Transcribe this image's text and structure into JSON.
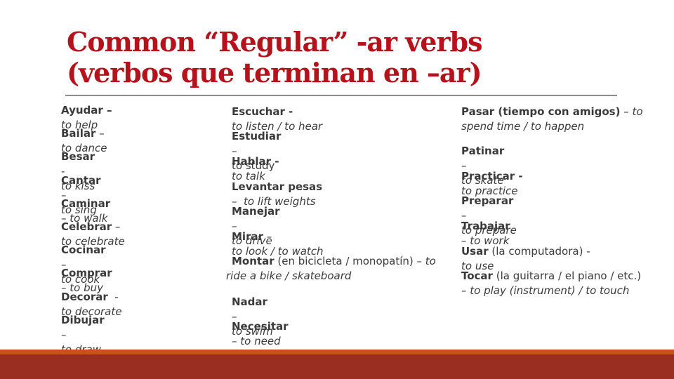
{
  "title": {
    "line1": "Common “Regular” -ar verbs",
    "line2": "(verbos que terminan en –ar)"
  },
  "columns": [
    {
      "items": [
        {
          "verb": "Ayudar –",
          "extra": "",
          "sep": " ",
          "gloss": "to help"
        },
        {
          "verb": "Bailar",
          "extra": "",
          "sep": " – ",
          "gloss": "to dance"
        },
        {
          "verb": "Besar",
          "extra": "",
          "sep": "  - ",
          "gloss": "to kiss"
        },
        {
          "verb": "Cantar",
          "extra": "",
          "sep": " – ",
          "gloss": "to sing"
        },
        {
          "verb": "Caminar",
          "extra": "",
          "sep": " – ",
          "gloss": "to walk"
        },
        {
          "verb": "Celebrar",
          "extra": "",
          "sep": " – ",
          "gloss": "to celebrate"
        },
        {
          "verb": "Cocinar",
          "extra": "",
          "sep": " – ",
          "gloss": "to cook"
        },
        {
          "verb": "Comprar",
          "extra": "",
          "sep": " – ",
          "gloss": "to buy"
        },
        {
          "verb": "Decorar",
          "extra": "",
          "sep": "  - ",
          "gloss": "to decorate"
        },
        {
          "verb": "Dibujar",
          "extra": "",
          "sep": " – ",
          "gloss": "to draw"
        }
      ]
    },
    {
      "items": [
        {
          "verb": "Escuchar -",
          "extra": "",
          "sep": "  ",
          "gloss": "to listen / to hear"
        },
        {
          "verb": "Estudiar",
          "extra": "",
          "sep": " – ",
          "gloss": "to study",
          "gloss_plain": true
        },
        {
          "verb": "Hablar -",
          "extra": "",
          "sep": "  ",
          "gloss": "to talk"
        },
        {
          "verb": "Levantar pesas",
          "extra": "",
          "sep": " –  ",
          "gloss": "to lift weights"
        },
        {
          "verb": "Manejar",
          "extra": "",
          "sep": " – ",
          "gloss": "to drive"
        },
        {
          "verb": "Mirar",
          "extra": "",
          "sep": " – ",
          "gloss": "to look / to watch"
        },
        {
          "verb": "Montar",
          "extra": " (en bicicleta / monopatín) –",
          "sep": " ",
          "gloss": "to ride a bike / skateboard"
        },
        {
          "verb": "Nadar",
          "extra": "",
          "sep": " – ",
          "gloss": "to swim"
        },
        {
          "verb": "Necesitar",
          "extra": "",
          "sep": " – ",
          "gloss": "to need"
        }
      ]
    },
    {
      "items": [
        {
          "verb": "Pasar (tiempo con amigos)",
          "extra": "",
          "sep": " – ",
          "gloss": "to spend time / to happen"
        },
        {
          "verb": "Patinar",
          "extra": "",
          "sep": " – ",
          "gloss": "to skate"
        },
        {
          "verb": "Practicar -",
          "extra": "",
          "sep": "  ",
          "gloss": "to practice"
        },
        {
          "verb": "Preparar",
          "extra": "",
          "sep": " – ",
          "gloss": "to prepare"
        },
        {
          "verb": "Trabajar",
          "extra": "",
          "sep": " – ",
          "gloss": "to work"
        },
        {
          "verb": "Usar",
          "extra": " (la computadora) -",
          "sep": "  ",
          "gloss": "to use"
        },
        {
          "verb": "Tocar",
          "extra": " (la guitarra / el piano / etc.) –",
          "sep": " ",
          "gloss": "to play (instrument) / to touch"
        }
      ]
    }
  ],
  "colors": {
    "title": "#b5121b",
    "text": "#3a3a3a",
    "footer_stripe": "#c9501f",
    "footer": "#9a2e20"
  }
}
